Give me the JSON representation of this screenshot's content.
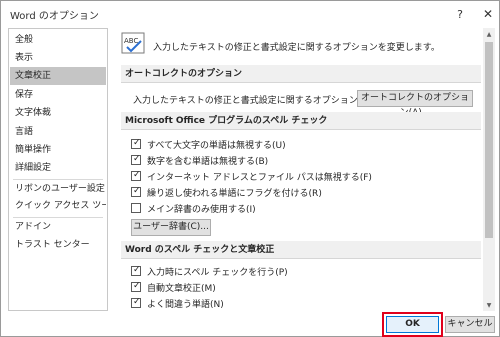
{
  "window": {
    "title": "Word のオプション",
    "help_glyph": "?",
    "close_glyph": "✕"
  },
  "sidebar": {
    "items": [
      {
        "label": "全般"
      },
      {
        "label": "表示"
      },
      {
        "label": "文章校正",
        "selected": true
      },
      {
        "label": "保存"
      },
      {
        "label": "文字体裁"
      },
      {
        "label": "言語"
      },
      {
        "label": "簡単操作"
      },
      {
        "label": "詳細設定"
      },
      {
        "label": "リボンのユーザー設定"
      },
      {
        "label": "クイック アクセス ツール バー"
      },
      {
        "label": "アドイン"
      },
      {
        "label": "トラスト センター"
      }
    ]
  },
  "main": {
    "header": {
      "icon": "abc-check-icon",
      "text": "入力したテキストの修正と書式設定に関するオプションを変更します。"
    },
    "autocorrect": {
      "title": "オートコレクトのオプション",
      "description": "入力したテキストの修正と書式設定に関するオプションを変更します。",
      "button_label": "オートコレクトのオプション(A)..."
    },
    "office_spelling": {
      "title": "Microsoft Office プログラムのスペル チェック",
      "options": [
        {
          "label": "すべて大文字の単語は無視する(U)",
          "checked": true
        },
        {
          "label": "数字を含む単語は無視する(B)",
          "checked": true
        },
        {
          "label": "インターネット アドレスとファイル パスは無視する(F)",
          "checked": true
        },
        {
          "label": "繰り返し使われる単語にフラグを付ける(R)",
          "checked": true
        },
        {
          "label": "メイン辞書のみ使用する(I)",
          "checked": false
        }
      ],
      "dictionary_button": "ユーザー辞書(C)..."
    },
    "word_spelling": {
      "title": "Word のスペル チェックと文章校正",
      "options": [
        {
          "label": "入力時にスペル チェックを行う(P)",
          "checked": true
        },
        {
          "label": "自動文章校正(M)",
          "checked": true
        },
        {
          "label": "よく間違う単語(N)",
          "checked": true
        }
      ]
    }
  },
  "footer": {
    "ok_label": "OK",
    "cancel_label": "キャンセル"
  },
  "colors": {
    "highlight": "#e0001b",
    "selected_nav": "#c5c5c5",
    "section_bg": "#f0f0f0",
    "ok_border": "#0078d7"
  }
}
